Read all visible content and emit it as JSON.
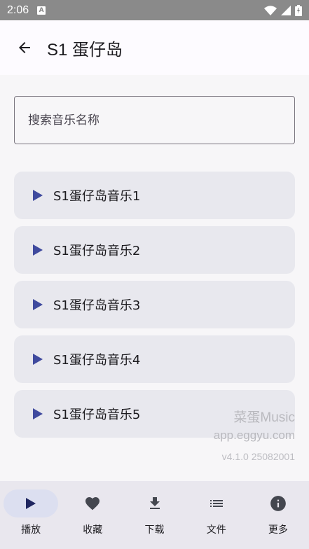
{
  "status_bar": {
    "time": "2:06",
    "badge": "A"
  },
  "app_bar": {
    "title": "S1 蛋仔岛"
  },
  "search": {
    "placeholder": "搜索音乐名称"
  },
  "tracks": [
    {
      "label": "S1蛋仔岛音乐1"
    },
    {
      "label": "S1蛋仔岛音乐2"
    },
    {
      "label": "S1蛋仔岛音乐3"
    },
    {
      "label": "S1蛋仔岛音乐4"
    },
    {
      "label": "S1蛋仔岛音乐5"
    }
  ],
  "watermark": {
    "brand": "菜蛋Music",
    "site": "app.eggyu.com",
    "version": "v4.1.0 25082001"
  },
  "bottom_nav": {
    "items": [
      {
        "label": "播放",
        "icon": "play-icon",
        "active": true
      },
      {
        "label": "收藏",
        "icon": "heart-icon",
        "active": false
      },
      {
        "label": "下载",
        "icon": "download-icon",
        "active": false
      },
      {
        "label": "文件",
        "icon": "list-icon",
        "active": false
      },
      {
        "label": "更多",
        "icon": "info-icon",
        "active": false
      }
    ]
  },
  "colors": {
    "accent": "#3f4a9e",
    "card": "#e8e8ee",
    "nav_bg": "#e9e7ee",
    "active_pill": "#dcdff0"
  }
}
